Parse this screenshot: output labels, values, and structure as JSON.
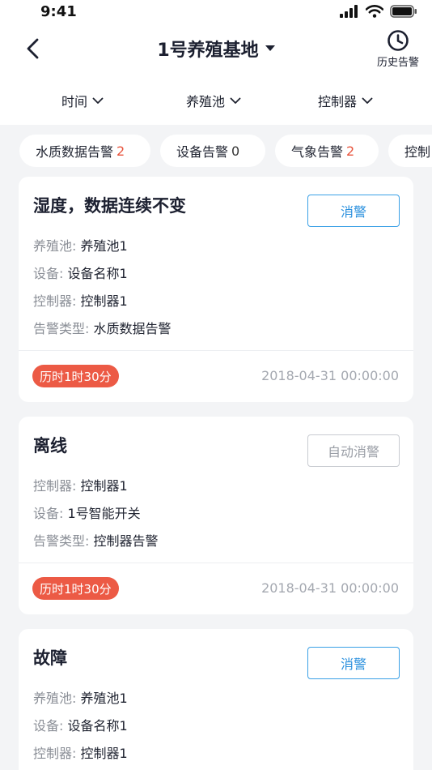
{
  "status_bar": {
    "time": "9:41"
  },
  "header": {
    "title": "1号养殖基地",
    "history_label": "历史告警"
  },
  "filters": [
    {
      "label": "时间"
    },
    {
      "label": "养殖池"
    },
    {
      "label": "控制器"
    }
  ],
  "chips": [
    {
      "label": "水质数据告警",
      "count": "2"
    },
    {
      "label": "设备告警",
      "count": "0"
    },
    {
      "label": "气象告警",
      "count": "2"
    },
    {
      "label": "控制",
      "count": ""
    }
  ],
  "alerts": [
    {
      "title": "湿度，数据连续不变",
      "action": "消警",
      "fields": [
        {
          "label": "养殖池:",
          "value": "养殖池1"
        },
        {
          "label": "设备:",
          "value": "设备名称1"
        },
        {
          "label": "控制器:",
          "value": "控制器1"
        },
        {
          "label": "告警类型:",
          "value": "水质数据告警"
        }
      ],
      "duration": "历时1时30分",
      "time": "2018-04-31 00:00:00"
    },
    {
      "title": "离线",
      "action": "自动消警",
      "fields": [
        {
          "label": "控制器:",
          "value": "控制器1"
        },
        {
          "label": "设备:",
          "value": "1号智能开关"
        },
        {
          "label": "告警类型:",
          "value": "控制器告警"
        }
      ],
      "duration": "历时1时30分",
      "time": "2018-04-31 00:00:00"
    },
    {
      "title": "故障",
      "action": "消警",
      "fields": [
        {
          "label": "养殖池:",
          "value": "养殖池1"
        },
        {
          "label": "设备:",
          "value": "设备名称1"
        },
        {
          "label": "控制器:",
          "value": "控制器1"
        }
      ]
    }
  ],
  "colors": {
    "accent": "#2a90de",
    "alert": "#ec5a45",
    "count": "#e8533c"
  },
  "icons": [
    "signal-icon",
    "wifi-icon",
    "battery-icon",
    "back-arrow-icon",
    "caret-down-icon",
    "clock-icon",
    "chevron-down-icon"
  ]
}
